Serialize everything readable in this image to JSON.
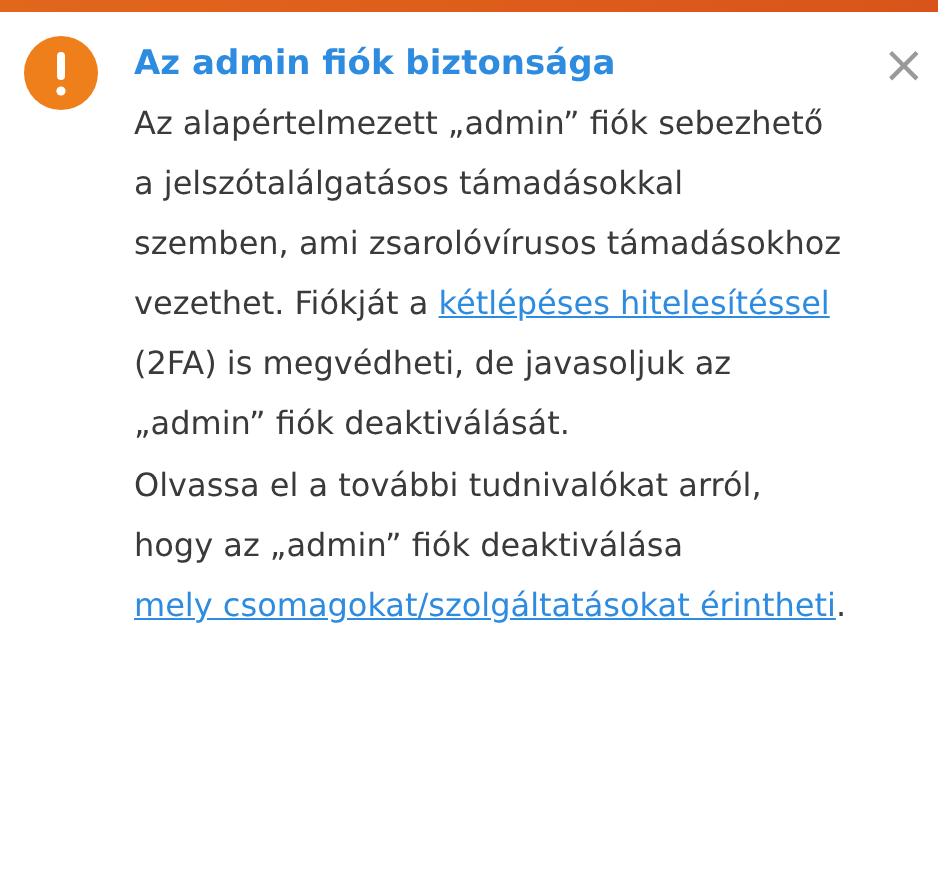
{
  "title": "Az admin fiók biztonsága",
  "close": "×",
  "paragraphs": [
    [
      {
        "kind": "text",
        "text": "Az alapértelmezett „admin” fiók sebezhető a jelszótalálgatásos támadásokkal szemben, ami zsarolóvírusos támadásokhoz vezethet. Fiókját a "
      },
      {
        "kind": "link",
        "text": "kétlépéses hitelesítéssel"
      },
      {
        "kind": "text",
        "text": " (2FA) is megvédheti, de javasoljuk az „admin” fiók deaktiválását."
      }
    ],
    [
      {
        "kind": "text",
        "text": "Olvassa el a további tudnivalókat arról, hogy az „admin” fiók deaktiválása "
      },
      {
        "kind": "link",
        "text": "mely csomagokat/szolgáltatásokat érintheti"
      },
      {
        "kind": "text",
        "text": "."
      }
    ]
  ]
}
